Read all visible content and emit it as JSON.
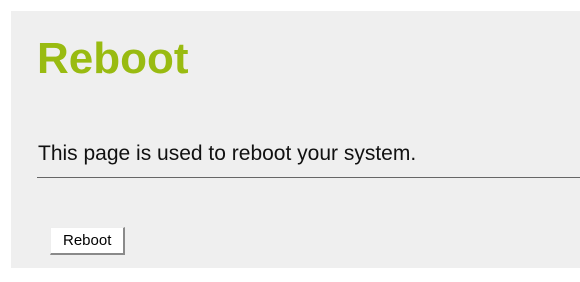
{
  "page": {
    "title": "Reboot",
    "description": "This page is used to reboot your system.",
    "reboot_button_label": "Reboot"
  },
  "colors": {
    "title": "#99bb11",
    "panel_background": "#efefef",
    "divider": "#666666"
  }
}
